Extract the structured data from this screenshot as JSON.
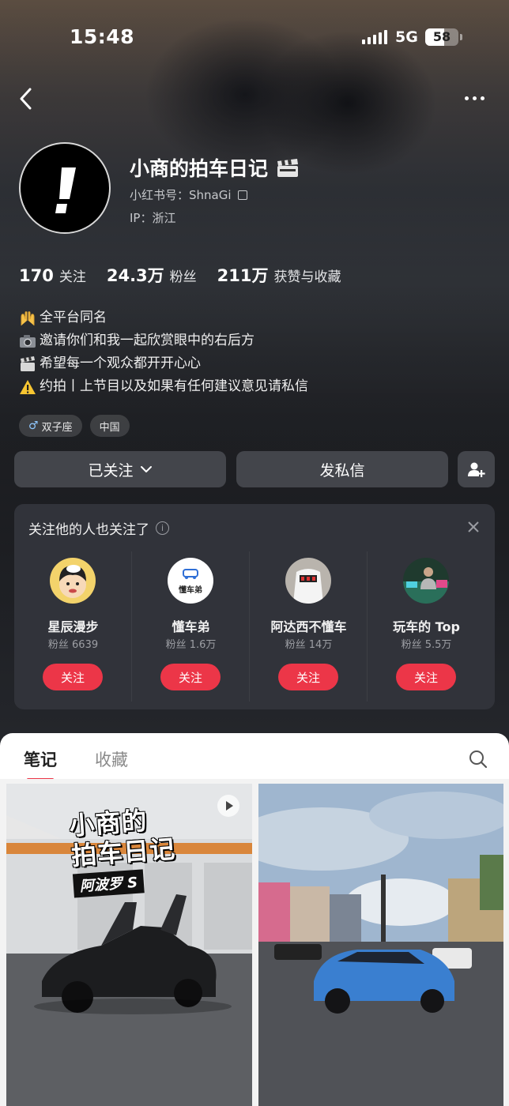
{
  "status_bar": {
    "time": "15:48",
    "network": "5G",
    "battery": "58",
    "battery_level": 0.58
  },
  "profile": {
    "nickname": "小商的拍车日记",
    "nickname_icon": "clapperboard-icon",
    "id_label": "小红书号：ShnaGi",
    "ip_label": "IP：浙江",
    "avatar_symbol": "!"
  },
  "stats": [
    {
      "value": "170",
      "label": "关注"
    },
    {
      "value": "24.3万",
      "label": "粉丝"
    },
    {
      "value": "211万",
      "label": "获赞与收藏"
    }
  ],
  "bio": [
    {
      "icon": "raised-hands-icon",
      "text": "全平台同名"
    },
    {
      "icon": "camera-icon",
      "text": "邀请你们和我一起欣赏眼中的右后方"
    },
    {
      "icon": "clapperboard-icon",
      "text": "希望每一个观众都开开心心"
    },
    {
      "icon": "warning-icon",
      "text": "约拍丨上节目以及如果有任何建议意见请私信"
    }
  ],
  "tags": [
    {
      "icon": "gemini-icon",
      "text": "双子座"
    },
    {
      "icon": "",
      "text": "中国"
    }
  ],
  "actions": {
    "follow": "已关注",
    "message": "发私信"
  },
  "recommend": {
    "title": "关注他的人也关注了",
    "items": [
      {
        "name": "星辰漫步",
        "fans": "粉丝 6639",
        "button": "关注"
      },
      {
        "name": "懂车弟",
        "fans": "粉丝 1.6万",
        "button": "关注",
        "avatar_text": "懂车弟"
      },
      {
        "name": "阿达西不懂车",
        "fans": "粉丝 14万",
        "button": "关注"
      },
      {
        "name": "玩车的 Top",
        "fans": "粉丝 5.5万",
        "button": "关注"
      }
    ]
  },
  "feed": {
    "tabs": [
      "笔记",
      "收藏"
    ],
    "cover1": {
      "line1": "小商的",
      "line2": "拍车日记",
      "line3": "阿波罗 S"
    }
  },
  "colors": {
    "accent": "#ec3648",
    "background": "#24262b"
  }
}
